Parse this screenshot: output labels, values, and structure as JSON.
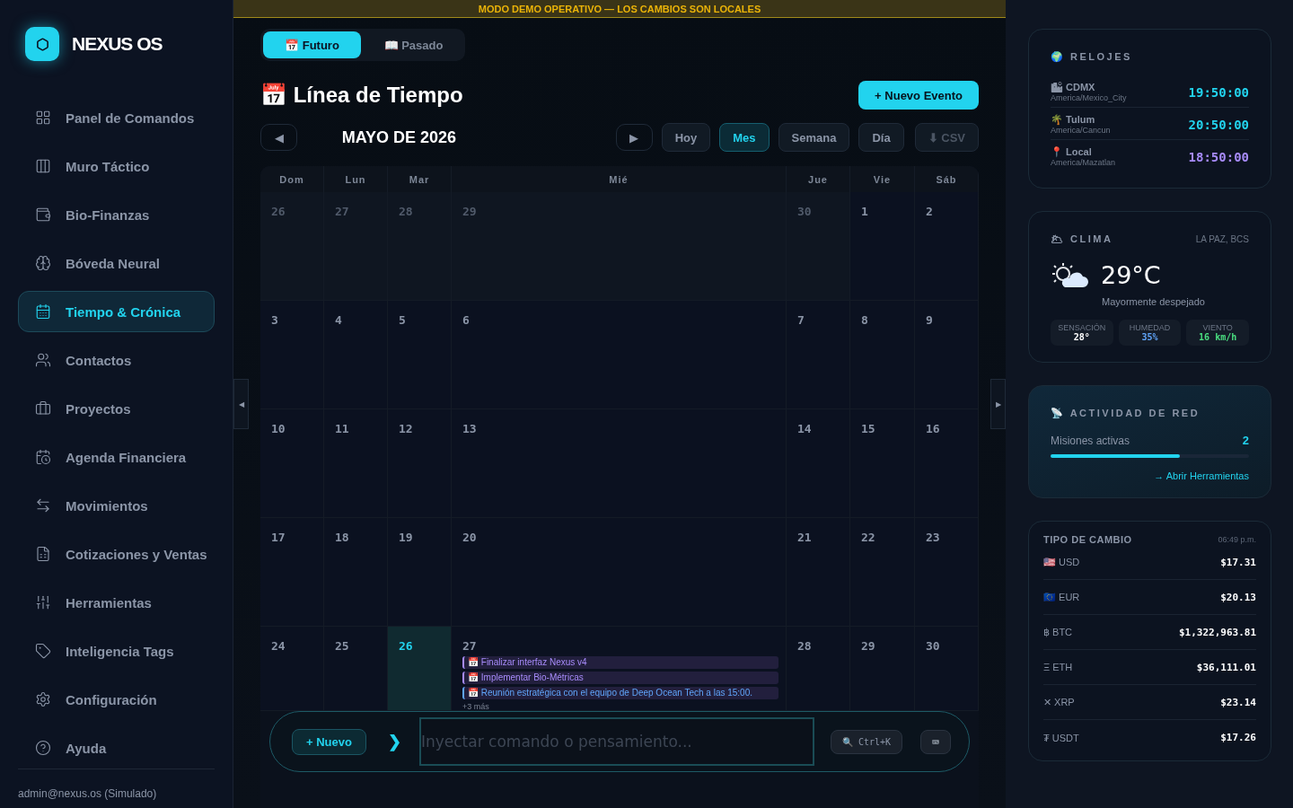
{
  "brand": {
    "name": "NEXUS OS"
  },
  "sidebar": {
    "items": [
      {
        "label": "Panel de Comandos",
        "selected": false
      },
      {
        "label": "Muro Táctico",
        "selected": false
      },
      {
        "label": "Bio-Finanzas",
        "selected": false
      },
      {
        "label": "Bóveda Neural",
        "selected": false
      },
      {
        "label": "Tiempo & Crónica",
        "selected": true
      },
      {
        "label": "Contactos",
        "selected": false
      },
      {
        "label": "Proyectos",
        "selected": false
      },
      {
        "label": "Agenda Financiera",
        "selected": false
      },
      {
        "label": "Movimientos",
        "selected": false
      },
      {
        "label": "Cotizaciones y Ventas",
        "selected": false
      },
      {
        "label": "Herramientas",
        "selected": false
      },
      {
        "label": "Inteligencia Tags",
        "selected": false
      },
      {
        "label": "Configuración",
        "selected": false
      },
      {
        "label": "Ayuda",
        "selected": false
      }
    ],
    "user": "admin@nexus.os (Simulado)"
  },
  "collapse_toggles": {
    "left": "◀",
    "right": "▶"
  },
  "banner": "MODO DEMO OPERATIVO — LOS CAMBIOS SON LOCALES",
  "mode_tabs": [
    {
      "label": "📅 Futuro",
      "selected": true
    },
    {
      "label": "📖 Pasado",
      "selected": false
    }
  ],
  "title": "📅 Línea de Tiempo",
  "new_event_button": "+ Nuevo Evento",
  "nav": {
    "prev": "◀",
    "month": "MAYO DE 2026",
    "next": "▶",
    "today": "Hoy",
    "views": [
      {
        "label": "Mes",
        "selected": true
      },
      {
        "label": "Semana",
        "selected": false
      },
      {
        "label": "Día",
        "selected": false
      }
    ],
    "export": {
      "label": "⬇ CSV",
      "disabled": true
    }
  },
  "calendar": {
    "weekdays": [
      "Dom",
      "Lun",
      "Mar",
      "Mié",
      "Jue",
      "Vie",
      "Sáb"
    ],
    "weeks": [
      [
        {
          "day": "26",
          "muted": true
        },
        {
          "day": "27",
          "muted": true
        },
        {
          "day": "28",
          "muted": true
        },
        {
          "day": "29",
          "muted": true
        },
        {
          "day": "30",
          "muted": true
        },
        {
          "day": "1",
          "muted": false
        },
        {
          "day": "2",
          "muted": false
        }
      ],
      [
        {
          "day": "3",
          "muted": false
        },
        {
          "day": "4",
          "muted": false
        },
        {
          "day": "5",
          "muted": false
        },
        {
          "day": "6",
          "muted": false
        },
        {
          "day": "7",
          "muted": false
        },
        {
          "day": "8",
          "muted": false
        },
        {
          "day": "9",
          "muted": false
        }
      ],
      [
        {
          "day": "10",
          "muted": false
        },
        {
          "day": "11",
          "muted": false
        },
        {
          "day": "12",
          "muted": false
        },
        {
          "day": "13",
          "muted": false
        },
        {
          "day": "14",
          "muted": false
        },
        {
          "day": "15",
          "muted": false
        },
        {
          "day": "16",
          "muted": false
        }
      ],
      [
        {
          "day": "17",
          "muted": false
        },
        {
          "day": "18",
          "muted": false
        },
        {
          "day": "19",
          "muted": false
        },
        {
          "day": "20",
          "muted": false
        },
        {
          "day": "21",
          "muted": false
        },
        {
          "day": "22",
          "muted": false
        },
        {
          "day": "23",
          "muted": false
        }
      ],
      [
        {
          "day": "24",
          "muted": false
        },
        {
          "day": "25",
          "muted": false
        },
        {
          "day": "26",
          "muted": false,
          "today": true
        },
        {
          "day": "27",
          "muted": false,
          "events": [
            {
              "title": "📅 Finalizar interfaz Nexus v4",
              "color": "#a78bfa"
            },
            {
              "title": "📅 Implementar Bio-Métricas",
              "color": "#a78bfa"
            },
            {
              "title": "📅 Reunión estratégica con el equipo de Deep Ocean Tech a las 15:00.",
              "color": "#60a5fa"
            }
          ],
          "more": "+3 más"
        },
        {
          "day": "28",
          "muted": false
        },
        {
          "day": "29",
          "muted": false
        },
        {
          "day": "30",
          "muted": false
        }
      ]
    ]
  },
  "composer": {
    "new_button": "+ Nuevo",
    "prompt": "❯",
    "placeholder": "Inyectar comando o pensamiento...",
    "search_shortcut": "🔍 Ctrl+K",
    "keyboard_button": "⌨"
  },
  "clocks": {
    "title": "🌍 RELOJES",
    "items": [
      {
        "name": "🏙 CDMX",
        "zone": "America/Mexico_City",
        "time": "19:50:00",
        "color": "#22d3ee"
      },
      {
        "name": "🌴 Tulum",
        "zone": "America/Cancun",
        "time": "20:50:00",
        "color": "#22d3ee"
      },
      {
        "name": "📍 Local",
        "zone": "America/Mazatlan",
        "time": "18:50:00",
        "color": "#a78bfa"
      }
    ]
  },
  "weather": {
    "title": "🌥 CLIMA",
    "location": "LA PAZ, BCS",
    "temperature": "29°C",
    "summary": "Mayormente despejado",
    "stats": [
      {
        "label": "SENSACIÓN",
        "value": "28°",
        "color": "#ffffff"
      },
      {
        "label": "HUMEDAD",
        "value": "35%",
        "color": "#60a5fa"
      },
      {
        "label": "VIENTO",
        "value": "16 km/h",
        "color": "#4ade80"
      }
    ]
  },
  "network": {
    "title": "📡 ACTIVIDAD DE RED",
    "label": "Misiones activas",
    "count": "2",
    "level": 0.65,
    "link": "→ Abrir Herramientas"
  },
  "exchange": {
    "title": "TIPO DE CAMBIO",
    "updated": "06:49 p.m.",
    "rows": [
      {
        "currency": "🇺🇸 USD",
        "rate": "$17.31"
      },
      {
        "currency": "🇪🇺 EUR",
        "rate": "$20.13"
      },
      {
        "currency": "฿ BTC",
        "rate": "$1,322,963.81"
      },
      {
        "currency": "Ξ ETH",
        "rate": "$36,111.01"
      },
      {
        "currency": "✕ XRP",
        "rate": "$23.14"
      },
      {
        "currency": "₮ USDT",
        "rate": "$17.26"
      }
    ]
  }
}
